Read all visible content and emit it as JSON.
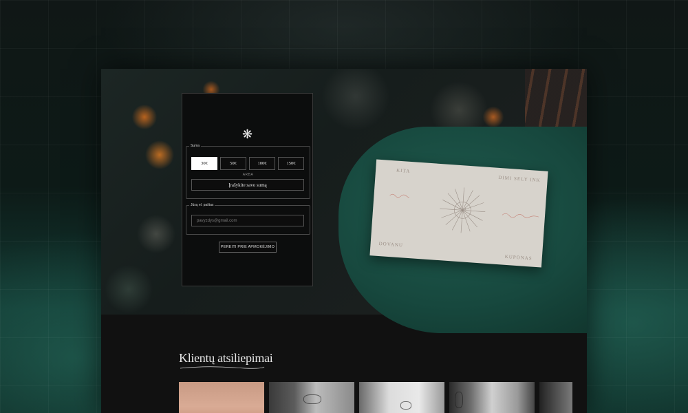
{
  "form": {
    "logo_glyph": "❋",
    "amount_legend": "Suma",
    "amounts": [
      "30€",
      "50€",
      "100€",
      "150€"
    ],
    "selected_amount": "30€",
    "or_text": "ARBA",
    "custom_amount_label": "Įrašykite savo sumą",
    "email_legend": "Jūsų el. paštas",
    "email_placeholder": "pavyzdys@gmail.com",
    "pay_button": "PEREITI PRIE APMOKĖJIMO"
  },
  "voucher_card": {
    "top_left": "KITA",
    "top_right": "DIMI SELY INK",
    "bottom_left": "DOVANU",
    "bottom_right": "KUPONAS"
  },
  "reviews": {
    "title": "Klientų atsiliepimai"
  }
}
